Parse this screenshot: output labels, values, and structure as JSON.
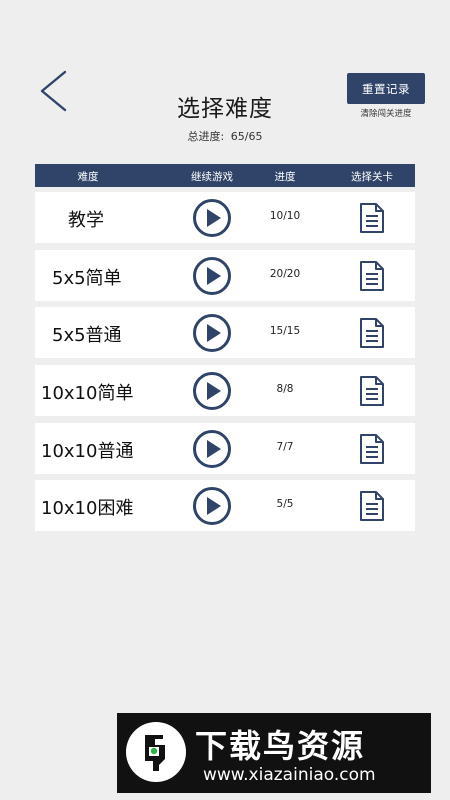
{
  "header": {
    "title": "选择难度",
    "progress_label": "总进度:",
    "progress_value": "65/65",
    "reset_button": "重置记录",
    "reset_note": "清除闯关进度"
  },
  "table": {
    "columns": [
      "难度",
      "继续游戏",
      "进度",
      "选择关卡"
    ],
    "rows": [
      {
        "name": "教学",
        "progress": "10/10"
      },
      {
        "name": "5x5简单",
        "progress": "20/20"
      },
      {
        "name": "5x5普通",
        "progress": "15/15"
      },
      {
        "name": "10x10简单",
        "progress": "8/8"
      },
      {
        "name": "10x10普通",
        "progress": "7/7"
      },
      {
        "name": "10x10困难",
        "progress": "5/5"
      }
    ]
  },
  "icons": {
    "back": "chevron-left-icon",
    "play": "play-circle-icon",
    "levels": "document-list-icon"
  },
  "colors": {
    "accent": "#2f4468",
    "background": "#eeeeee",
    "row": "#ffffff"
  },
  "watermark": {
    "name": "下载鸟资源",
    "url": "www.xiazainiao.com"
  }
}
